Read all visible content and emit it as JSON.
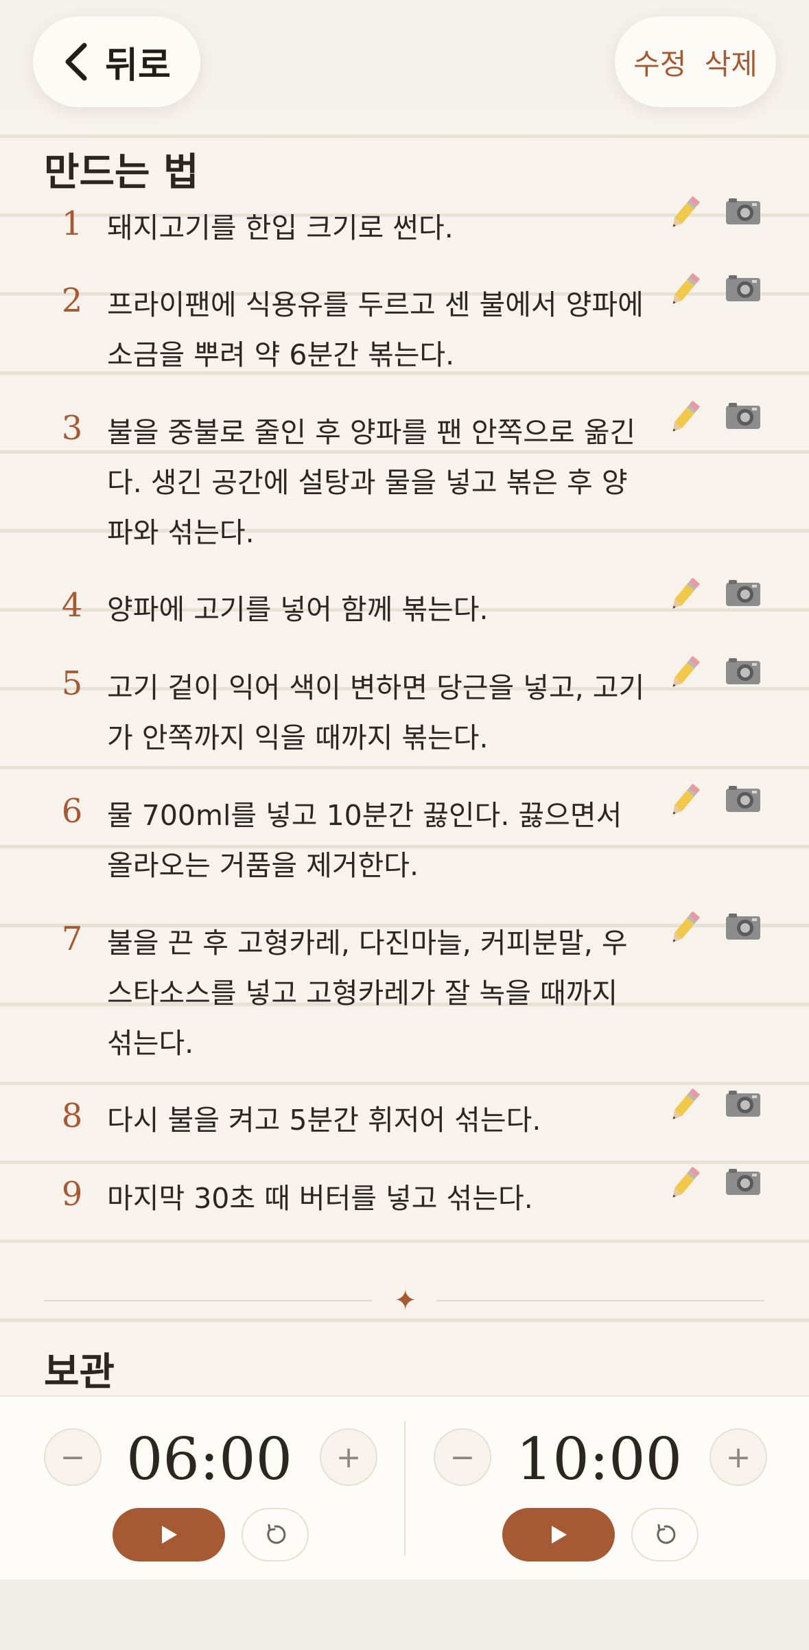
{
  "header": {
    "back_label": "뒤로",
    "edit_label": "수정",
    "delete_label": "삭제"
  },
  "instructions": {
    "title": "만드는 법",
    "steps": [
      {
        "num": "1",
        "text": "돼지고기를 한입 크기로 썬다."
      },
      {
        "num": "2",
        "text": "프라이팬에 식용유를 두르고 센 불에서 양파에 소금을 뿌려 약 6분간 볶는다."
      },
      {
        "num": "3",
        "text": "불을 중불로 줄인 후 양파를 팬 안쪽으로 옮긴다. 생긴 공간에 설탕과 물을 넣고 볶은 후 양파와 섞는다."
      },
      {
        "num": "4",
        "text": "양파에 고기를 넣어 함께 볶는다."
      },
      {
        "num": "5",
        "text": "고기 겉이 익어 색이 변하면 당근을 넣고, 고기가 안쪽까지 익을 때까지 볶는다."
      },
      {
        "num": "6",
        "text": "물 700ml를 넣고 10분간 끓인다. 끓으면서 올라오는 거품을 제거한다."
      },
      {
        "num": "7",
        "text": "불을 끈 후 고형카레, 다진마늘, 커피분말, 우스타소스를 넣고 고형카레가 잘 녹을 때까지 섞는다."
      },
      {
        "num": "8",
        "text": "다시 불을 켜고 5분간 휘저어 섞는다."
      },
      {
        "num": "9",
        "text": "마지막 30초 때 버터를 넣고 섞는다."
      }
    ]
  },
  "storage": {
    "title": "보관"
  },
  "timers": [
    {
      "time": "06:00"
    },
    {
      "time": "10:00"
    }
  ],
  "colors": {
    "accent": "#a65a34",
    "background": "#f7f3ec",
    "text": "#2b2621"
  }
}
